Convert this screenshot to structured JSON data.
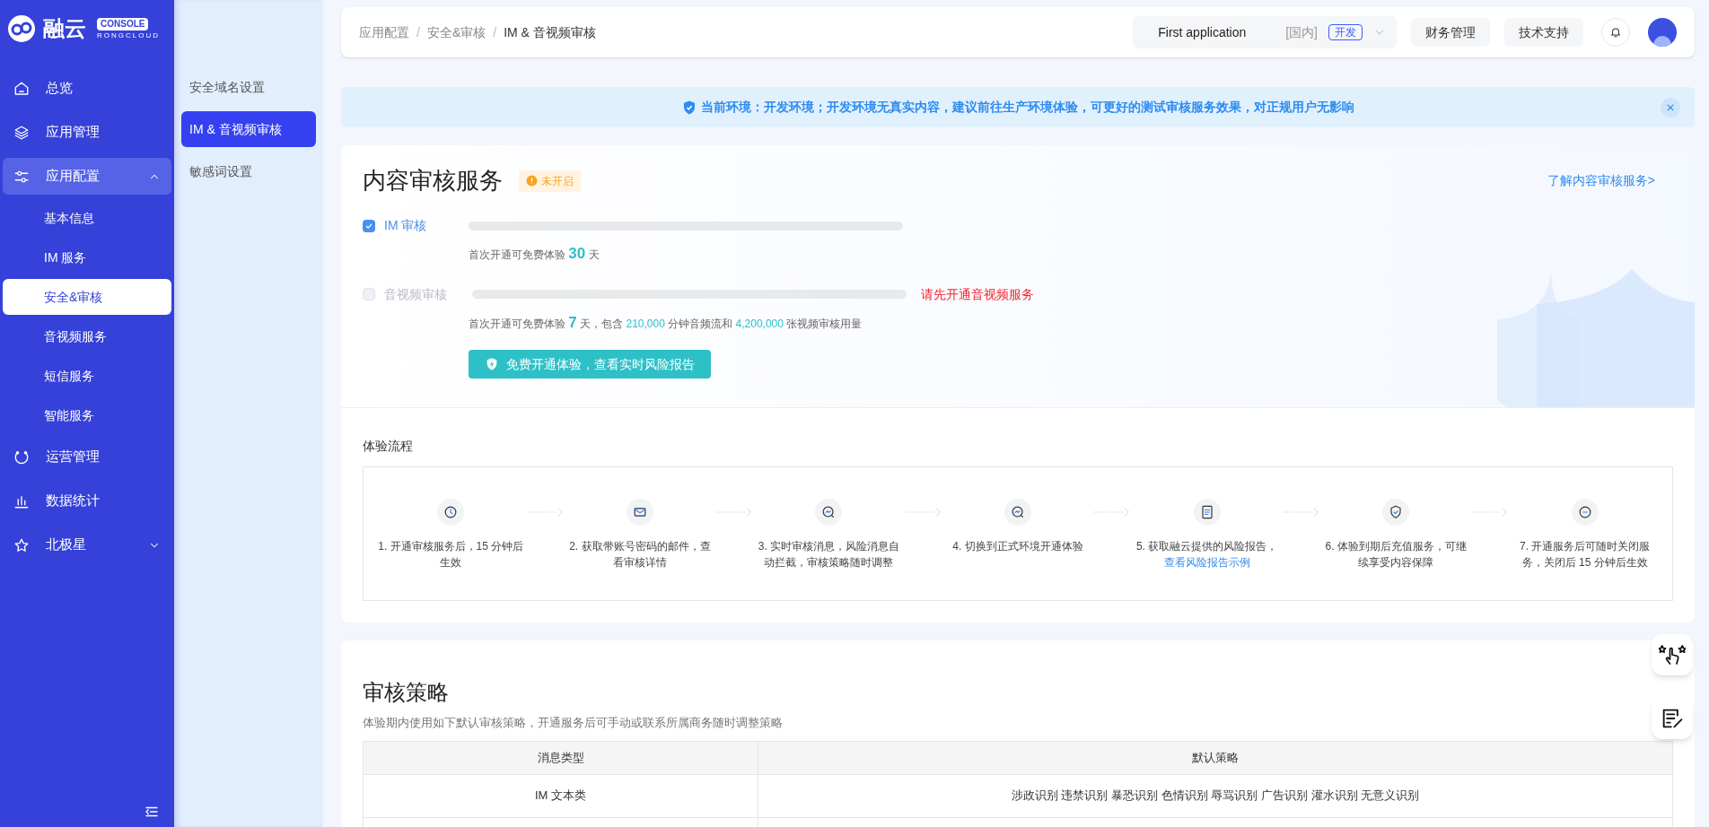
{
  "logo": {
    "name": "融云",
    "badge": "CONSOLE",
    "sub": "RONGCLOUD"
  },
  "sidebar": {
    "items": [
      {
        "label": "总览",
        "selected": false
      },
      {
        "label": "应用管理",
        "selected": false
      },
      {
        "label": "应用配置",
        "expanded": true,
        "selected": true,
        "children": [
          {
            "label": "基本信息",
            "selected": false
          },
          {
            "label": "IM 服务",
            "selected": false
          },
          {
            "label": "安全&审核",
            "selected": true
          },
          {
            "label": "音视频服务",
            "selected": false
          },
          {
            "label": "短信服务",
            "selected": false
          },
          {
            "label": "智能服务",
            "selected": false
          }
        ]
      },
      {
        "label": "运营管理",
        "selected": false
      },
      {
        "label": "数据统计",
        "selected": false
      },
      {
        "label": "北极星",
        "selected": false,
        "expanded": false
      }
    ]
  },
  "subnav": {
    "items": [
      {
        "label": "安全域名设置",
        "selected": false
      },
      {
        "label": "IM & 音视频审核",
        "selected": true
      },
      {
        "label": "敏感词设置",
        "selected": false
      }
    ]
  },
  "breadcrumb": {
    "items": [
      "应用配置",
      "安全&审核",
      "IM & 音视频审核"
    ],
    "separators": [
      "/",
      "/"
    ]
  },
  "header": {
    "app_name": "First application",
    "region": "[国内]",
    "env": "开发",
    "buttons": [
      "财务管理",
      "技术支持"
    ]
  },
  "banner": {
    "text": "当前环境：开发环境；开发环境无真实内容，建议前往生产环境体验，可更好的测试审核服务效果，对正规用户无影响"
  },
  "service": {
    "title": "内容审核服务",
    "status": "未开启",
    "learn_more": "了解内容审核服务>",
    "options": [
      {
        "label": "IM 审核",
        "checked": true,
        "disabled": false,
        "note": [
          {
            "text": "首次开通可免费体验 "
          },
          {
            "text": "30",
            "kind": "big"
          },
          {
            "text": " 天"
          }
        ]
      },
      {
        "label": "音视频审核",
        "checked": false,
        "disabled": true,
        "warning": "请先开通音视频服务",
        "note": [
          {
            "text": "首次开通可免费体验 "
          },
          {
            "text": "7",
            "kind": "big"
          },
          {
            "text": " 天，包含 "
          },
          {
            "text": "210,000",
            "kind": "num"
          },
          {
            "text": " 分钟音频流和 "
          },
          {
            "text": "4,200,000",
            "kind": "num"
          },
          {
            "text": " 张视频审核用量"
          }
        ]
      }
    ],
    "button": "免费开通体验，查看实时风险报告"
  },
  "flow": {
    "title": "体验流程",
    "steps": [
      {
        "text": "1. 开通审核服务后，15 分钟后生效"
      },
      {
        "text": "2. 获取带账号密码的邮件，查看审核详情"
      },
      {
        "text": "3. 实时审核消息，风险消息自动拦截，审核策略随时调整"
      },
      {
        "text": "4. 切换到正式环境开通体验"
      },
      {
        "text": "5. 获取融云提供的风险报告，",
        "link": "查看风险报告示例"
      },
      {
        "text": "6. 体验到期后充值服务，可继续享受内容保障"
      },
      {
        "text": "7. 开通服务后可随时关闭服务，关闭后 15 分钟后生效"
      }
    ]
  },
  "policy": {
    "title": "审核策略",
    "subtitle": "体验期内使用如下默认审核策略，开通服务后可手动或联系所属商务随时调整策略",
    "table": {
      "columns": [
        "消息类型",
        "默认策略"
      ],
      "rows": [
        [
          "IM 文本类",
          "涉政识别 违禁识别 暴恐识别 色情识别 辱骂识别 广告识别 灌水识别 无意义识别"
        ]
      ]
    }
  }
}
